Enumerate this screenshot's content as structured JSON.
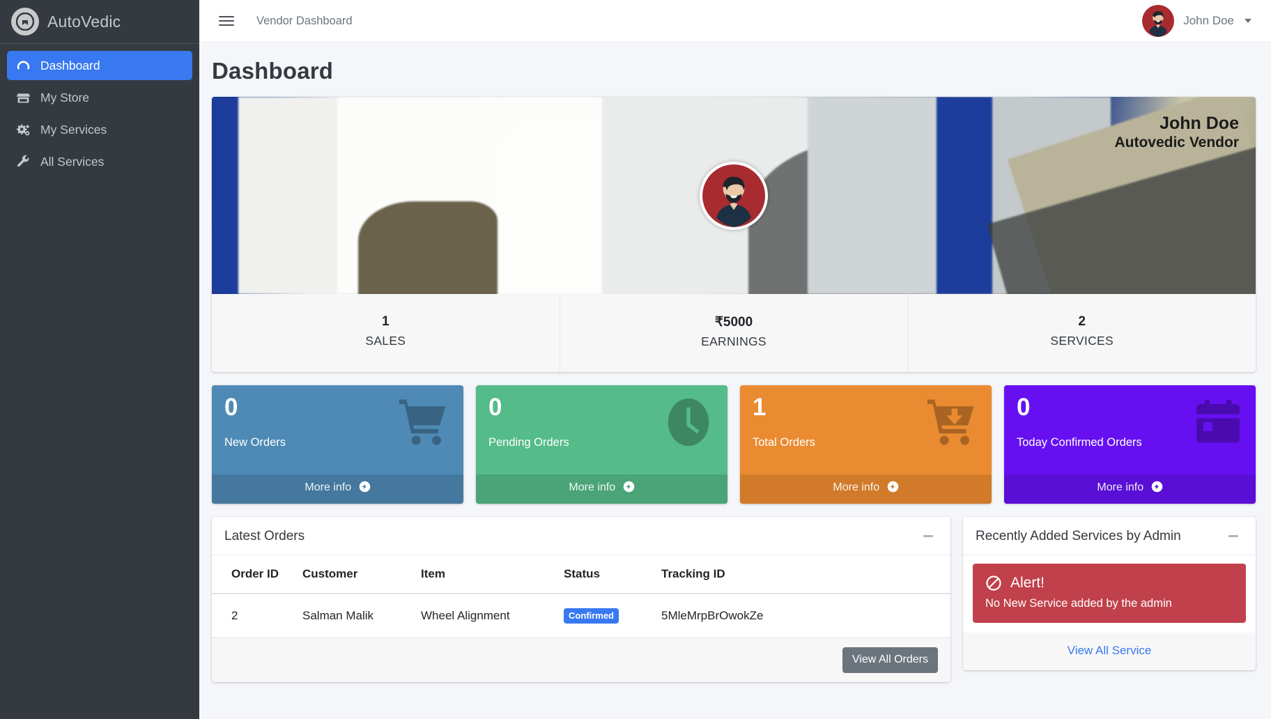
{
  "sidebar": {
    "brand": {
      "label": "AutoVedic",
      "logo_icon": "autovedic-logo-icon"
    },
    "items": [
      {
        "label": "Dashboard",
        "icon": "speedometer-icon",
        "active": true
      },
      {
        "label": "My Store",
        "icon": "store-icon",
        "active": false
      },
      {
        "label": "My Services",
        "icon": "gears-icon",
        "active": false
      },
      {
        "label": "All Services",
        "icon": "wrench-icon",
        "active": false
      }
    ]
  },
  "topbar": {
    "menu_toggle_icon": "hamburger-icon",
    "link_label": "Vendor Dashboard",
    "user_name": "John Doe",
    "caret_icon": "caret-down-icon",
    "avatar_icon": "user-avatar"
  },
  "page": {
    "title": "Dashboard"
  },
  "profile": {
    "banner_name": "John Doe",
    "banner_role": "Autovedic Vendor",
    "avatar_icon": "user-avatar",
    "stats": [
      {
        "value": "1",
        "label": "SALES"
      },
      {
        "value": "₹5000",
        "label": "EARNINGS"
      },
      {
        "value": "2",
        "label": "SERVICES"
      }
    ]
  },
  "infoboxes": [
    {
      "value": "0",
      "label": "New Orders",
      "footer": "More info",
      "color": "#4e8ab5",
      "footer_color": "#44789e",
      "icon": "shopping-cart-icon"
    },
    {
      "value": "0",
      "label": "Pending Orders",
      "footer": "More info",
      "color": "#55bb89",
      "footer_color": "#4aa478",
      "icon": "clock-icon"
    },
    {
      "value": "1",
      "label": "Total Orders",
      "footer": "More info",
      "color": "#ea8b31",
      "footer_color": "#d17b2a",
      "icon": "cart-arrow-down-icon"
    },
    {
      "value": "0",
      "label": "Today Confirmed Orders",
      "footer": "More info",
      "color": "#6610f2",
      "footer_color": "#5a0fd6",
      "icon": "calendar-icon"
    }
  ],
  "latest_orders": {
    "title": "Latest Orders",
    "collapse_icon": "minus-icon",
    "columns": [
      "Order ID",
      "Customer",
      "Item",
      "Status",
      "Tracking ID"
    ],
    "rows": [
      {
        "order_id": "2",
        "customer": "Salman Malik",
        "item": "Wheel Alignment",
        "status": "Confirmed",
        "status_color": "#3878f0",
        "tracking_id": "5MleMrpBrOwokZe"
      }
    ],
    "view_all_label": "View All Orders"
  },
  "recent_services": {
    "title": "Recently Added Services by Admin",
    "collapse_icon": "minus-icon",
    "alert": {
      "icon": "ban-icon",
      "heading": "Alert!",
      "message": "No New Service added by the admin",
      "color": "#c0414b"
    },
    "view_all_label": "View All Service"
  },
  "colors": {
    "sidebar_bg": "#343a40",
    "accent": "#3878f0",
    "page_bg": "#f4f6f9"
  }
}
